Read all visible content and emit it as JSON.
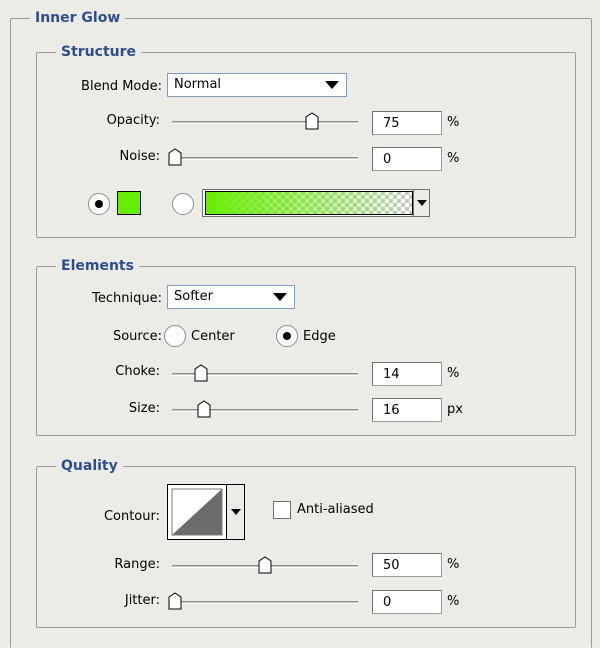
{
  "panel_title": "Inner Glow",
  "structure": {
    "title": "Structure",
    "blend_mode_label": "Blend Mode:",
    "blend_mode_value": "Normal",
    "opacity_label": "Opacity:",
    "opacity_value": "75",
    "opacity_unit": "%",
    "opacity_slider": 0.75,
    "noise_label": "Noise:",
    "noise_value": "0",
    "noise_unit": "%",
    "noise_slider": 0.0,
    "glow_color": "#66ee00"
  },
  "elements": {
    "title": "Elements",
    "technique_label": "Technique:",
    "technique_value": "Softer",
    "source_label": "Source:",
    "source_center_label": "Center",
    "source_edge_label": "Edge",
    "source_selected": "Edge",
    "choke_label": "Choke:",
    "choke_value": "14",
    "choke_unit": "%",
    "choke_slider": 0.14,
    "size_label": "Size:",
    "size_value": "16",
    "size_unit": "px",
    "size_slider": 0.16
  },
  "quality": {
    "title": "Quality",
    "contour_label": "Contour:",
    "anti_aliased_label": "Anti-aliased",
    "anti_aliased_checked": false,
    "range_label": "Range:",
    "range_value": "50",
    "range_unit": "%",
    "range_slider": 0.5,
    "jitter_label": "Jitter:",
    "jitter_value": "0",
    "jitter_unit": "%",
    "jitter_slider": 0.0
  }
}
